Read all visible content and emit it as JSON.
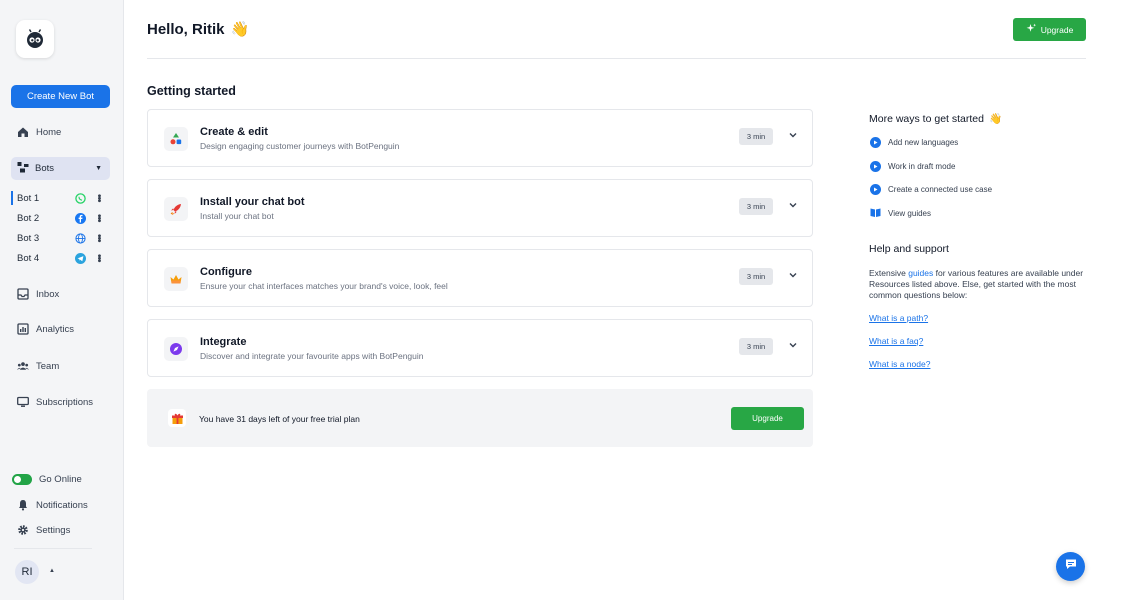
{
  "sidebar": {
    "create_label": "Create New Bot",
    "nav": {
      "home": "Home",
      "bots": "Bots",
      "inbox": "Inbox",
      "analytics": "Analytics",
      "team": "Team",
      "subscriptions": "Subscriptions",
      "go_online": "Go Online",
      "notifications": "Notifications",
      "settings": "Settings"
    },
    "bots": [
      {
        "name": "Bot 1",
        "channel": "whatsapp-icon"
      },
      {
        "name": "Bot 2",
        "channel": "facebook-icon"
      },
      {
        "name": "Bot 3",
        "channel": "globe-icon"
      },
      {
        "name": "Bot 4",
        "channel": "telegram-icon"
      }
    ],
    "avatar_initials": "RI"
  },
  "header": {
    "greeting": "Hello, Ritik",
    "greeting_emoji": "👋",
    "upgrade_label": "Upgrade"
  },
  "main": {
    "section_title": "Getting started",
    "cards": [
      {
        "title": "Create & edit",
        "subtitle": "Design engaging customer journeys with BotPenguin",
        "duration": "3 min",
        "icon": "shapes-icon"
      },
      {
        "title": "Install your chat bot",
        "subtitle": "Install your chat bot",
        "duration": "3 min",
        "icon": "rocket-icon"
      },
      {
        "title": "Configure",
        "subtitle": "Ensure your chat interfaces matches your brand's voice, look, feel",
        "duration": "3 min",
        "icon": "crown-icon"
      },
      {
        "title": "Integrate",
        "subtitle": "Discover and integrate your favourite apps with BotPenguin",
        "duration": "3 min",
        "icon": "compass-icon"
      }
    ],
    "trial": {
      "text": "You have 31 days left of your free trial plan",
      "button_label": "Upgrade"
    }
  },
  "right": {
    "more_title": "More ways to get started",
    "more_emoji": "👋",
    "more_links": [
      {
        "label": "Add new languages"
      },
      {
        "label": "Work in draft mode"
      },
      {
        "label": "Create a connected use case"
      }
    ],
    "guides_label": "View guides",
    "help_title": "Help and support",
    "help_text_before": "Extensive ",
    "help_text_link": "guides",
    "help_text_after": " for various features are available under Resources listed above. Else, get started with the most common questions below:",
    "faqs": [
      "What is a path?",
      "What is a faq?",
      "What is a node?"
    ]
  },
  "colors": {
    "primary": "#1a73e8",
    "success": "#28a745",
    "sidebar_bg": "#f4f5f7"
  }
}
